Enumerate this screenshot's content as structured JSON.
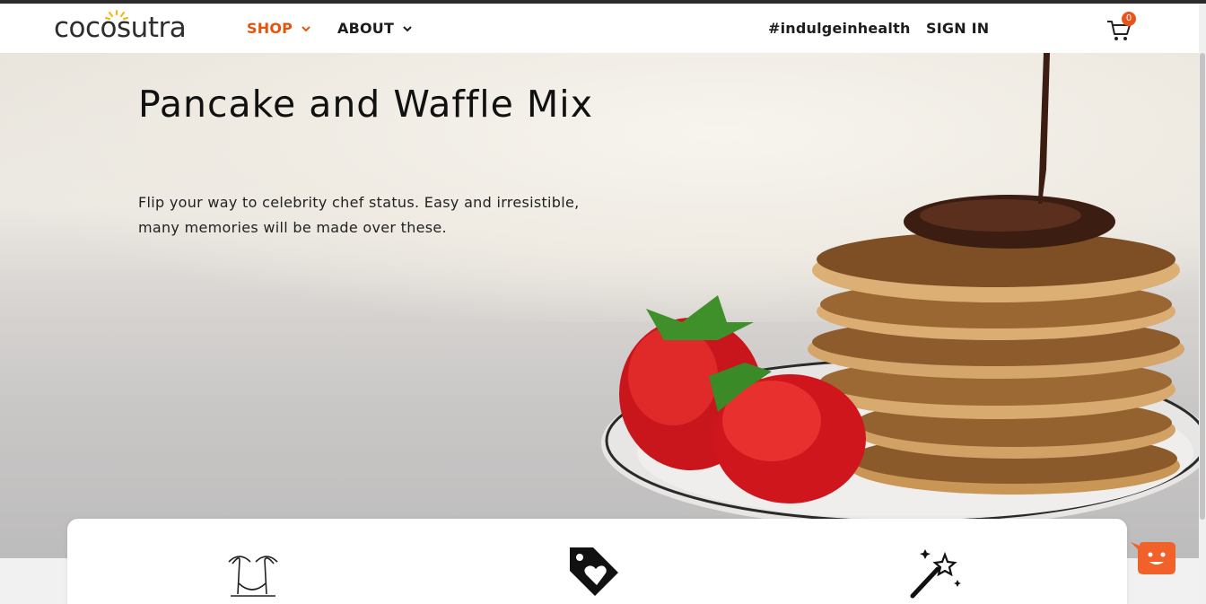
{
  "header": {
    "logo": "cocosutra",
    "nav": {
      "shop": "SHOP",
      "about": "ABOUT",
      "hashtag": "#indulgeinhealth",
      "sign_in": "SIGN IN"
    },
    "cart_count": "0"
  },
  "hero": {
    "title": "Pancake and Waffle Mix",
    "subtitle": "Flip your way to celebrity chef status. Easy and irresistible, many memories will be made over these."
  },
  "features": {
    "icons": [
      "palm-trees-hammock-icon",
      "heart-tag-icon",
      "magic-wand-icon"
    ]
  },
  "colors": {
    "brand_orange": "#e0560d",
    "chat_orange": "#f0622a",
    "text_dark": "#1c1c1c"
  }
}
